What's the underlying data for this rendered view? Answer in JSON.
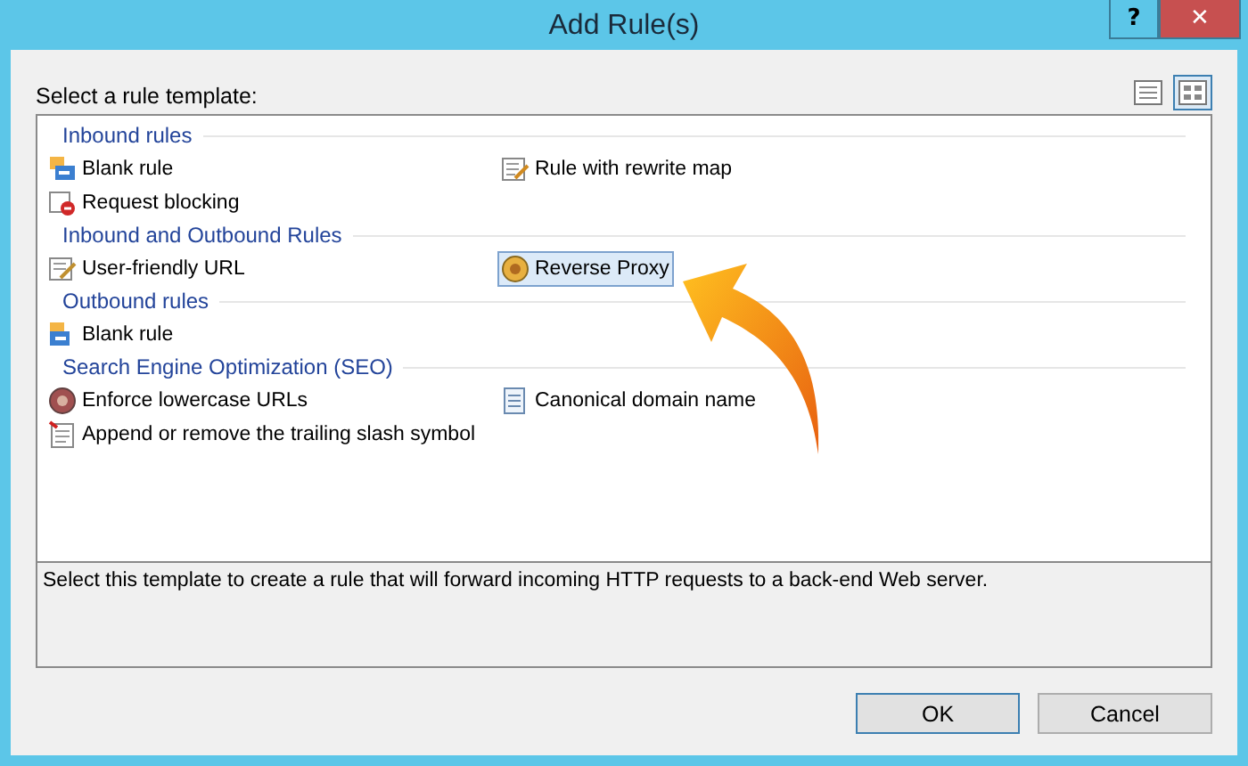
{
  "window": {
    "title": "Add Rule(s)",
    "help": "?",
    "close": "✕"
  },
  "prompt": "Select a rule template:",
  "view_buttons": [
    {
      "kind": "details",
      "selected": false
    },
    {
      "kind": "tiles",
      "selected": true
    }
  ],
  "groups": [
    {
      "title": "Inbound rules",
      "items": [
        {
          "label": "Blank rule",
          "selected": false
        },
        {
          "label": "Rule with rewrite map",
          "selected": false
        },
        {
          "label": "Request blocking",
          "selected": false
        }
      ]
    },
    {
      "title": "Inbound and Outbound Rules",
      "items": [
        {
          "label": "User-friendly URL",
          "selected": false
        },
        {
          "label": "Reverse Proxy",
          "selected": true
        }
      ]
    },
    {
      "title": "Outbound rules",
      "items": [
        {
          "label": "Blank rule",
          "selected": false
        }
      ]
    },
    {
      "title": "Search Engine Optimization (SEO)",
      "items": [
        {
          "label": "Enforce lowercase URLs",
          "selected": false
        },
        {
          "label": "Canonical domain name",
          "selected": false
        },
        {
          "label": "Append or remove the trailing slash symbol",
          "selected": false
        }
      ]
    }
  ],
  "description": "Select this template to create a rule that will forward incoming HTTP requests to a back-end Web server.",
  "buttons": [
    {
      "label": "OK",
      "default": true
    },
    {
      "label": "Cancel",
      "default": false
    }
  ]
}
